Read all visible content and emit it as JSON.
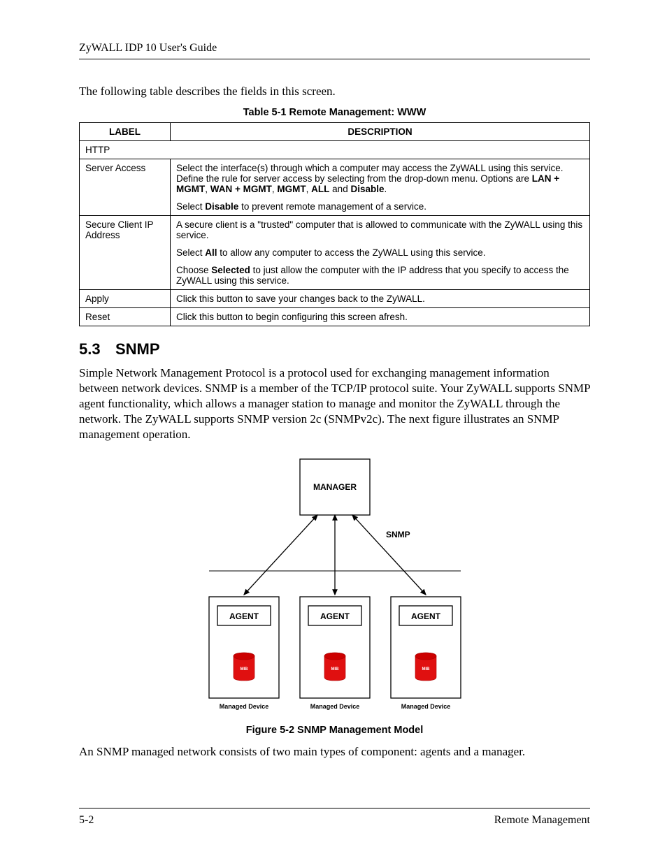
{
  "header": {
    "title": "ZyWALL IDP 10 User's Guide"
  },
  "intro": "The following table describes the fields in this screen.",
  "table": {
    "caption": "Table 5-1 Remote Management: WWW",
    "headers": {
      "label": "LABEL",
      "description": "DESCRIPTION"
    },
    "subheader": "HTTP",
    "rows": [
      {
        "label": "Server Access",
        "desc_p1_pre": "Select the interface(s) through which a computer may access the ZyWALL using this service. Define the rule for server access by selecting from the drop-down menu. Options are ",
        "opt1": "LAN + MGMT",
        "sep1": ", ",
        "opt2": "WAN + MGMT",
        "sep2": ", ",
        "opt3": "MGMT",
        "sep3": ", ",
        "opt4": "ALL",
        "sep4": " and ",
        "opt5": "Disable",
        "end1": ".",
        "desc_p2_pre": "Select ",
        "desc_p2_bold": "Disable",
        "desc_p2_post": " to prevent remote management of a service."
      },
      {
        "label": "Secure Client IP Address",
        "desc_p1": "A secure client is a \"trusted\" computer that is allowed to communicate with the ZyWALL using this service.",
        "desc_p2_pre": "Select ",
        "desc_p2_bold": "All",
        "desc_p2_post": " to allow any computer to access the ZyWALL using this service.",
        "desc_p3_pre": "Choose ",
        "desc_p3_bold": "Selected",
        "desc_p3_post": " to just allow the computer with the IP address that you specify to access the ZyWALL using this service."
      },
      {
        "label": "Apply",
        "desc": "Click this button to save your changes back to the ZyWALL."
      },
      {
        "label": "Reset",
        "desc": "Click this button to begin configuring this screen afresh."
      }
    ]
  },
  "section": {
    "number": "5.3",
    "title": "SNMP",
    "para1": "Simple Network Management Protocol is a protocol used for exchanging management information between network devices. SNMP is a member of the TCP/IP protocol suite. Your ZyWALL supports SNMP agent functionality, which allows a manager station to manage and monitor the ZyWALL through the network. The ZyWALL supports SNMP version 2c (SNMPv2c). The next figure illustrates an SNMP management operation.",
    "para2": "An SNMP managed network consists of two main types of component: agents and a manager."
  },
  "figure": {
    "caption": "Figure 5-2 SNMP Management Model",
    "labels": {
      "manager": "MANAGER",
      "snmp": "SNMP",
      "agent": "AGENT",
      "mib": "MIB",
      "managed_device": "Managed Device"
    }
  },
  "footer": {
    "page_num": "5-2",
    "section": "Remote Management"
  }
}
